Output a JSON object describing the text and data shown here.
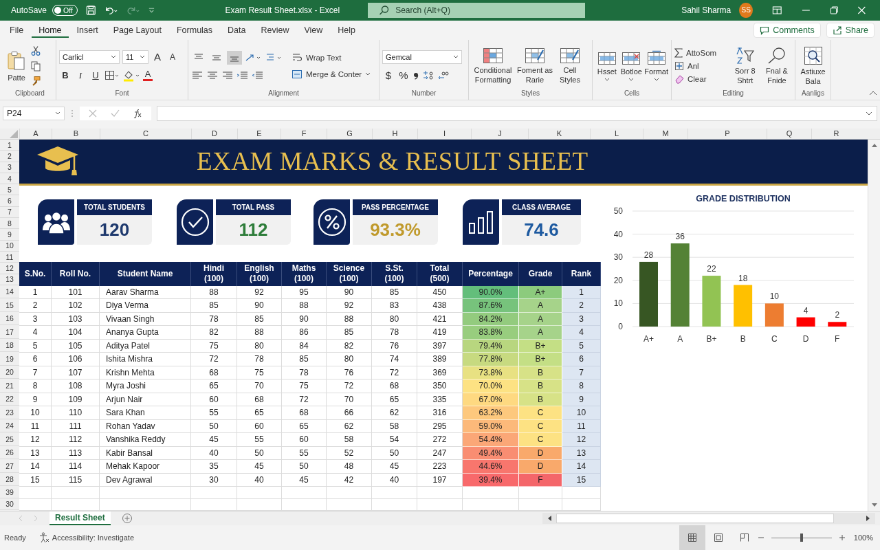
{
  "title_bar": {
    "autosave": "AutoSave",
    "autosave_toggle": {
      "label": "Off",
      "on": false
    },
    "title": "Exam Result Sheet.xlsx  -  Excel",
    "search": {
      "placeholder": "Search (Alt+Q)"
    },
    "user": "Sahil Sharma",
    "avatar": "SS"
  },
  "tabs": [
    {
      "label": "File",
      "selected": false
    },
    {
      "label": "Home",
      "selected": true
    },
    {
      "label": "Insert",
      "selected": false
    },
    {
      "label": "Page Layout",
      "selected": false
    },
    {
      "label": "Formulas",
      "selected": false
    },
    {
      "label": "Data",
      "selected": false
    },
    {
      "label": "Review",
      "selected": false
    },
    {
      "label": "View",
      "selected": false
    },
    {
      "label": "Help",
      "selected": false
    }
  ],
  "comments": "Comments",
  "share": "Share",
  "ribbon": {
    "clipboard": {
      "label": "Clipboard",
      "paste": "Patte"
    },
    "font": {
      "label": "Font",
      "name": "Carlicl",
      "size": "11",
      "grow": "A",
      "shrink": "A",
      "bold": "B",
      "italic": "I",
      "underline": "U",
      "font_color": "A"
    },
    "alignment": {
      "label": "Alignment",
      "vertical": [
        {
          "selected": false
        },
        {
          "selected": false
        },
        {
          "selected": true
        }
      ],
      "wrap": "Wrap Text",
      "merge": "Merge & Conter"
    },
    "number": {
      "label": "Number",
      "format": "Gemcal",
      "currency": "$",
      "percent": "%"
    },
    "styles": {
      "label": "Styles",
      "buttons": [
        "Conditional Formatting",
        "Foment as Rarie",
        "Cell Styles"
      ]
    },
    "cells": {
      "label": "Cells",
      "buttons": [
        "Hsset",
        "Botloe",
        "Format"
      ]
    },
    "editing": {
      "label": "Editing",
      "autosum": "AttoSom",
      "fill": "Anl",
      "clear": "Clear",
      "sort": "Sorr 8 Shtrt",
      "find": "Fnal & Fnide"
    },
    "addins": {
      "label": "Aanligs",
      "button": "Astiuxe Bala"
    }
  },
  "name_box": "P24",
  "columns": [
    "A",
    "B",
    "C",
    "D",
    "E",
    "F",
    "G",
    "H",
    "I",
    "J",
    "K",
    "L",
    "M",
    "P",
    "Q",
    "R"
  ],
  "row_numbers": [
    "1",
    "2",
    "3",
    "4",
    "5",
    "6",
    "7",
    "8",
    "9",
    "10",
    "11",
    "12",
    "13",
    "14",
    "15",
    "16",
    "17",
    "18",
    "19",
    "20",
    "21",
    "22",
    "23",
    "24",
    "25",
    "26",
    "27",
    "28",
    "39",
    "30"
  ],
  "banner": {
    "title": "EXAM MARKS & RESULT SHEET"
  },
  "kpis": [
    {
      "kind": "people",
      "label": "TOTAL STUDENTS",
      "value": "120",
      "color": "#1f3a6e"
    },
    {
      "kind": "check",
      "label": "TOTAL PASS",
      "value": "112",
      "color": "#2e7d3a"
    },
    {
      "kind": "percent",
      "label": "PASS PERCENTAGE",
      "value": "93.3%",
      "color": "#c09a2c"
    },
    {
      "kind": "bars",
      "label": "CLASS AVERAGE",
      "value": "74.6",
      "color": "#1e5aa0"
    }
  ],
  "table": {
    "columns": [
      "S.No.",
      "Roll No.",
      "Student Name",
      "Hindi\n(100)",
      "English\n(100)",
      "Maths\n(100)",
      "Science\n(100)",
      "S.St.\n(100)",
      "Total\n(500)",
      "Percentage",
      "Grade",
      "Rank"
    ],
    "rows": [
      {
        "sno": "1",
        "roll": "101",
        "name": "Aarav Sharma",
        "marks": [
          "88",
          "92",
          "95",
          "90",
          "85"
        ],
        "total": "450",
        "percentage": {
          "value": "90.0%",
          "color": "#63be7b"
        },
        "grade": {
          "value": "A+",
          "color": "#8ccb7d"
        },
        "rank": "1"
      },
      {
        "sno": "2",
        "roll": "102",
        "name": "Diya Verma",
        "marks": [
          "85",
          "90",
          "88",
          "92",
          "83"
        ],
        "total": "438",
        "percentage": {
          "value": "87.6%",
          "color": "#77c37c"
        },
        "grade": {
          "value": "A",
          "color": "#a6d38a"
        },
        "rank": "2"
      },
      {
        "sno": "3",
        "roll": "103",
        "name": "Vivaan Singh",
        "marks": [
          "78",
          "85",
          "90",
          "88",
          "80"
        ],
        "total": "421",
        "percentage": {
          "value": "84.2%",
          "color": "#93cb7e"
        },
        "grade": {
          "value": "A",
          "color": "#a6d38a"
        },
        "rank": "3"
      },
      {
        "sno": "4",
        "roll": "104",
        "name": "Ananya Gupta",
        "marks": [
          "82",
          "88",
          "86",
          "85",
          "78"
        ],
        "total": "419",
        "percentage": {
          "value": "83.8%",
          "color": "#98cd7e"
        },
        "grade": {
          "value": "A",
          "color": "#a6d38a"
        },
        "rank": "4"
      },
      {
        "sno": "5",
        "roll": "105",
        "name": "Aditya Patel",
        "marks": [
          "75",
          "80",
          "84",
          "82",
          "76"
        ],
        "total": "397",
        "percentage": {
          "value": "79.4%",
          "color": "#b8d67f"
        },
        "grade": {
          "value": "B+",
          "color": "#c4df85"
        },
        "rank": "5"
      },
      {
        "sno": "6",
        "roll": "106",
        "name": "Ishita Mishra",
        "marks": [
          "72",
          "78",
          "85",
          "80",
          "74"
        ],
        "total": "389",
        "percentage": {
          "value": "77.8%",
          "color": "#c7da80"
        },
        "grade": {
          "value": "B+",
          "color": "#c4df85"
        },
        "rank": "6"
      },
      {
        "sno": "7",
        "roll": "107",
        "name": "Krishn Mehta",
        "marks": [
          "68",
          "75",
          "78",
          "76",
          "72"
        ],
        "total": "369",
        "percentage": {
          "value": "73.8%",
          "color": "#e8e182"
        },
        "grade": {
          "value": "B",
          "color": "#d7e287"
        },
        "rank": "7"
      },
      {
        "sno": "8",
        "roll": "108",
        "name": "Myra Joshi",
        "marks": [
          "65",
          "70",
          "75",
          "72",
          "68"
        ],
        "total": "350",
        "percentage": {
          "value": "70.0%",
          "color": "#fde283"
        },
        "grade": {
          "value": "B",
          "color": "#d7e287"
        },
        "rank": "8"
      },
      {
        "sno": "9",
        "roll": "109",
        "name": "Arjun Nair",
        "marks": [
          "60",
          "68",
          "72",
          "70",
          "65"
        ],
        "total": "335",
        "percentage": {
          "value": "67.0%",
          "color": "#fed981"
        },
        "grade": {
          "value": "B",
          "color": "#d7e287"
        },
        "rank": "9"
      },
      {
        "sno": "10",
        "roll": "110",
        "name": "Sara Khan",
        "marks": [
          "55",
          "65",
          "68",
          "66",
          "62"
        ],
        "total": "316",
        "percentage": {
          "value": "63.2%",
          "color": "#fdc87d"
        },
        "grade": {
          "value": "C",
          "color": "#fde283"
        },
        "rank": "10"
      },
      {
        "sno": "11",
        "roll": "111",
        "name": "Rohan Yadav",
        "marks": [
          "50",
          "60",
          "65",
          "62",
          "58"
        ],
        "total": "295",
        "percentage": {
          "value": "59.0%",
          "color": "#fcb97a"
        },
        "grade": {
          "value": "C",
          "color": "#fde283"
        },
        "rank": "11"
      },
      {
        "sno": "12",
        "roll": "112",
        "name": "Vanshika Reddy",
        "marks": [
          "45",
          "55",
          "60",
          "58",
          "54"
        ],
        "total": "272",
        "percentage": {
          "value": "54.4%",
          "color": "#fba777"
        },
        "grade": {
          "value": "C",
          "color": "#fde283"
        },
        "rank": "12"
      },
      {
        "sno": "13",
        "roll": "113",
        "name": "Kabir Bansal",
        "marks": [
          "40",
          "50",
          "55",
          "52",
          "50"
        ],
        "total": "247",
        "percentage": {
          "value": "49.4%",
          "color": "#f98d72"
        },
        "grade": {
          "value": "D",
          "color": "#f9a96b"
        },
        "rank": "13"
      },
      {
        "sno": "14",
        "roll": "114",
        "name": "Mehak Kapoor",
        "marks": [
          "35",
          "45",
          "50",
          "48",
          "45"
        ],
        "total": "223",
        "percentage": {
          "value": "44.6%",
          "color": "#f8766d"
        },
        "grade": {
          "value": "D",
          "color": "#f9a96b"
        },
        "rank": "14"
      },
      {
        "sno": "15",
        "roll": "115",
        "name": "Dev Agrawal",
        "marks": [
          "30",
          "40",
          "45",
          "42",
          "40"
        ],
        "total": "197",
        "percentage": {
          "value": "39.4%",
          "color": "#f8696b"
        },
        "grade": {
          "value": "F",
          "color": "#f4666a"
        },
        "rank": "15"
      }
    ]
  },
  "chart_data": {
    "type": "bar",
    "title": "GRADE DISTRIBUTION",
    "categories": [
      "A+",
      "A",
      "B+",
      "B",
      "C",
      "D",
      "F"
    ],
    "values": [
      28,
      36,
      22,
      18,
      10,
      4,
      2
    ],
    "colors": [
      "#375623",
      "#548235",
      "#92c353",
      "#ffc000",
      "#ed7d31",
      "#ff0000",
      "#ff0000"
    ],
    "ylim": [
      0,
      50
    ],
    "yticks": [
      0,
      10,
      20,
      30,
      40,
      50
    ],
    "grid": true,
    "data_labels": true
  },
  "sheet_tabs": [
    {
      "label": "Result Sheet",
      "selected": true
    }
  ],
  "status_bar": {
    "ready": "Ready",
    "accessibility": "Accessibility: Investigate",
    "views": [
      {
        "selected": true
      },
      {
        "selected": false
      },
      {
        "selected": false
      }
    ],
    "zoom": {
      "level": 0.5
    },
    "zoom_label": "100%"
  }
}
